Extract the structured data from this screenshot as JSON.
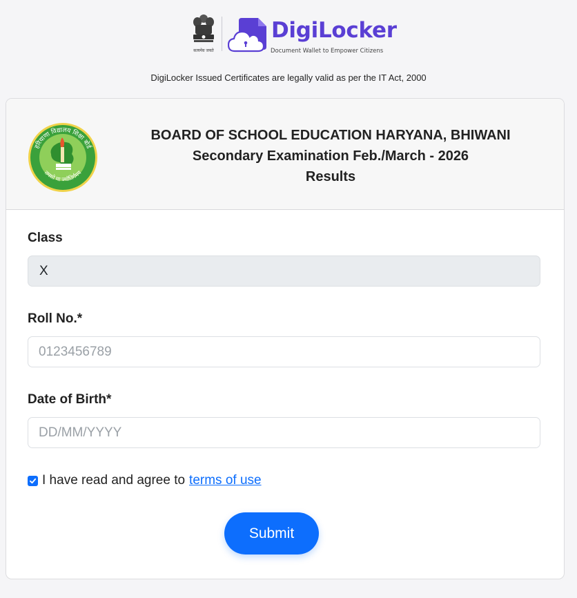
{
  "header": {
    "emblem_motto": "सत्यमेव जयते",
    "brand_title": "DigiLocker",
    "brand_tagline": "Document Wallet to Empower Citizens",
    "legal_note": "DigiLocker Issued Certificates are legally valid as per the IT Act, 2000"
  },
  "card": {
    "board_name": "BOARD OF SCHOOL EDUCATION HARYANA, BHIWANI",
    "exam_name": "Secondary Examination Feb./March - 2026",
    "section_title": "Results",
    "logo_text_top": "हरियाणा विद्यालय शिक्षा बोर्ड",
    "logo_text_bottom": "तमसो मा ज्योतिर्गमय"
  },
  "form": {
    "class_label": "Class",
    "class_value": "X",
    "roll_label": "Roll No.*",
    "roll_placeholder": "0123456789",
    "dob_label": "Date of Birth*",
    "dob_placeholder": "DD/MM/YYYY",
    "terms_text": "I have read and agree to",
    "terms_link": "terms of use",
    "terms_checked": true,
    "submit_label": "Submit"
  },
  "colors": {
    "brand_purple": "#5a3fd4",
    "primary_blue": "#0d6efd",
    "readonly_bg": "#e9ecef"
  },
  "icons": {
    "emblem": "national-emblem-icon",
    "digilocker": "digilocker-cloud-icon",
    "board": "board-logo-icon",
    "check": "check-icon"
  }
}
